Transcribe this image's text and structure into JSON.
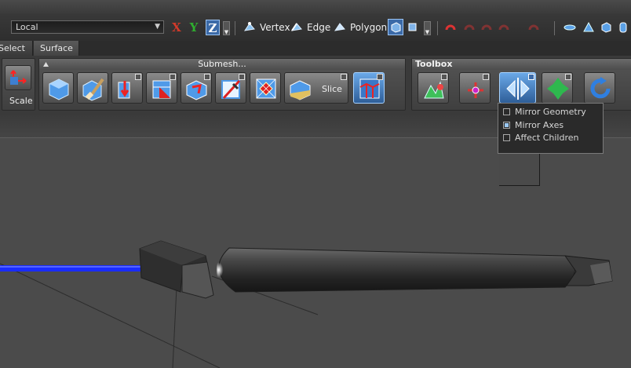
{
  "toolbar": {
    "coordinate_space": "Local",
    "axes": [
      "X",
      "Y",
      "Z"
    ],
    "active_axis": "Z",
    "modes": [
      "Vertex",
      "Edge",
      "Polygon"
    ]
  },
  "tabs": [
    "Select",
    "Surface"
  ],
  "ribbon": {
    "scale_label": "Scale",
    "submesh_title": "Submesh...",
    "slice_label": "Slice",
    "toolbox_title": "Toolbox"
  },
  "mirror_menu": {
    "options": [
      {
        "label": "Mirror Geometry",
        "checked": false
      },
      {
        "label": "Mirror Axes",
        "checked": true
      },
      {
        "label": "Affect Children",
        "checked": false
      }
    ]
  },
  "colors": {
    "accent_blue": "#3b6aa8",
    "axis_x": "#d23a2a",
    "axis_y": "#2fae2f",
    "manipulator_blue": "#1a2cff"
  }
}
